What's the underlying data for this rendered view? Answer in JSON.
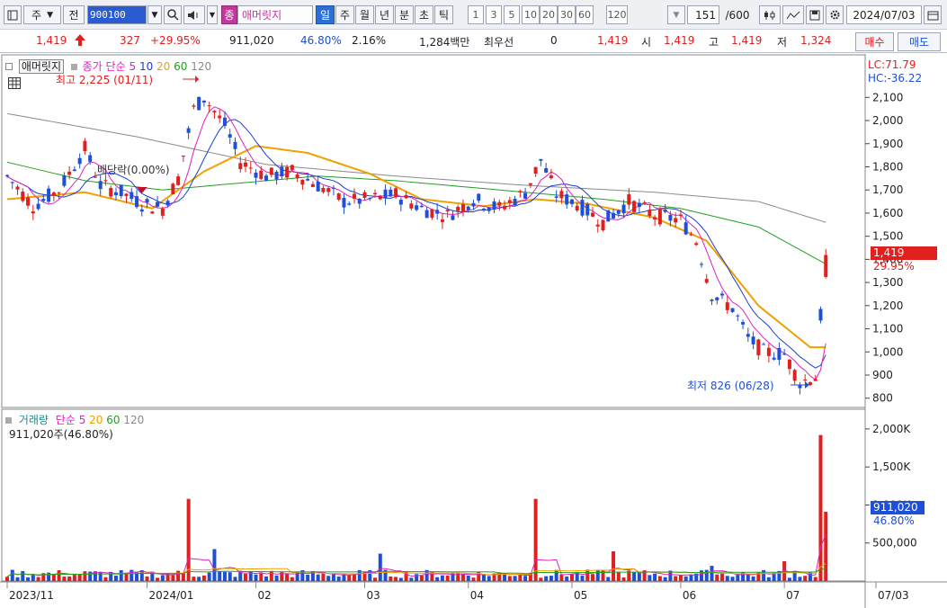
{
  "toolbar": {
    "market": "주",
    "prev": "전",
    "code": "900100",
    "name": "애머릿지",
    "name_badge": "종",
    "periods": [
      "일",
      "주",
      "월",
      "년",
      "분",
      "초",
      "틱"
    ],
    "active_period": "일",
    "intervals": [
      "1",
      "3",
      "5",
      "10",
      "20",
      "30",
      "60",
      "120"
    ],
    "count": "151",
    "count_max": "/600",
    "date": "2024/07/03"
  },
  "quote": {
    "price": "1,419",
    "change": "327",
    "change_pct": "+29.95%",
    "volume": "911,020",
    "volume_ratio": "46.80%",
    "turnover_pct": "2.16%",
    "amount": "1,284백만",
    "preferred_label": "최우선",
    "preferred_value": "0",
    "current": "1,419",
    "open_label": "시",
    "open": "1,419",
    "high_label": "고",
    "high": "1,419",
    "low_label": "저",
    "low": "1,324",
    "buy_label": "매수",
    "sell_label": "매도"
  },
  "legend": {
    "name": "애머릿지",
    "close_label": "종가 단순",
    "ma": [
      "5",
      "10",
      "20",
      "60",
      "120"
    ],
    "lc": "LC:71.79",
    "hc": "HC:-36.22",
    "high_note": "최고 2,225 (01/11)",
    "low_note": "최저 826 (06/28)",
    "dividend_note": "배당락(0.00%)",
    "price_tag": "1,419",
    "price_tag_pct": "29.95%"
  },
  "volume_legend": {
    "title": "거래량",
    "ma_label": "단순",
    "ma": [
      "5",
      "20",
      "60",
      "120"
    ],
    "current": "911,020주(46.80%)",
    "tag_value": "911,020",
    "tag_pct": "46.80%"
  },
  "colors": {
    "up": "#e0201e",
    "down": "#1e4fd8",
    "ma5": "#e020c0",
    "ma10": "#1a3fd0",
    "ma20": "#f0a000",
    "ma60": "#20a020",
    "ma120": "#8a8a8a"
  },
  "chart_data": {
    "type": "candlestick",
    "price_axis": {
      "ticks": [
        "2,100",
        "2,000",
        "1,900",
        "1,800",
        "1,700",
        "1,600",
        "1,500",
        "1,400",
        "1,300",
        "1,200",
        "1,100",
        "1,000",
        "900",
        "800"
      ],
      "range": [
        760,
        2280
      ]
    },
    "volume_axis": {
      "ticks": [
        "2,000K",
        "1,500K",
        "1,000K",
        "500,000"
      ],
      "range": [
        0,
        2200000
      ]
    },
    "x_labels": [
      "2023/11",
      "2024/01",
      "02",
      "03",
      "04",
      "05",
      "06",
      "07",
      "07/03"
    ],
    "ohlc_anchors": [
      [
        0,
        1760
      ],
      [
        5,
        1630
      ],
      [
        10,
        1700
      ],
      [
        15,
        1880
      ],
      [
        18,
        1720
      ],
      [
        22,
        1690
      ],
      [
        26,
        1640
      ],
      [
        30,
        1620
      ],
      [
        33,
        1750
      ],
      [
        36,
        2050
      ],
      [
        38,
        2100
      ],
      [
        42,
        1980
      ],
      [
        45,
        1820
      ],
      [
        50,
        1760
      ],
      [
        55,
        1780
      ],
      [
        60,
        1720
      ],
      [
        65,
        1650
      ],
      [
        70,
        1660
      ],
      [
        75,
        1680
      ],
      [
        80,
        1620
      ],
      [
        85,
        1590
      ],
      [
        90,
        1660
      ],
      [
        95,
        1620
      ],
      [
        100,
        1690
      ],
      [
        103,
        1830
      ],
      [
        106,
        1680
      ],
      [
        110,
        1640
      ],
      [
        115,
        1560
      ],
      [
        120,
        1650
      ],
      [
        125,
        1590
      ],
      [
        130,
        1570
      ],
      [
        133,
        1480
      ],
      [
        136,
        1250
      ],
      [
        140,
        1190
      ],
      [
        143,
        1060
      ],
      [
        146,
        1000
      ],
      [
        150,
        990
      ],
      [
        153,
        870
      ],
      [
        156,
        890
      ],
      [
        158,
        1419
      ]
    ],
    "volume_spikes": [
      [
        35,
        1080000
      ],
      [
        40,
        420000
      ],
      [
        72,
        360000
      ],
      [
        102,
        1080000
      ],
      [
        117,
        390000
      ],
      [
        136,
        200000
      ],
      [
        150,
        260000
      ],
      [
        157,
        1920000
      ],
      [
        158,
        911020
      ]
    ],
    "ma120_anchors": [
      [
        0,
        2030
      ],
      [
        25,
        1930
      ],
      [
        50,
        1810
      ],
      [
        75,
        1760
      ],
      [
        100,
        1720
      ],
      [
        125,
        1690
      ],
      [
        145,
        1650
      ],
      [
        158,
        1560
      ]
    ],
    "ma60_anchors": [
      [
        0,
        1820
      ],
      [
        15,
        1740
      ],
      [
        30,
        1700
      ],
      [
        45,
        1730
      ],
      [
        60,
        1760
      ],
      [
        75,
        1740
      ],
      [
        95,
        1700
      ],
      [
        115,
        1660
      ],
      [
        130,
        1620
      ],
      [
        145,
        1540
      ],
      [
        158,
        1380
      ]
    ],
    "ma20_anchors": [
      [
        0,
        1660
      ],
      [
        15,
        1690
      ],
      [
        28,
        1620
      ],
      [
        38,
        1780
      ],
      [
        48,
        1890
      ],
      [
        58,
        1860
      ],
      [
        70,
        1770
      ],
      [
        80,
        1660
      ],
      [
        92,
        1630
      ],
      [
        102,
        1660
      ],
      [
        112,
        1640
      ],
      [
        125,
        1580
      ],
      [
        135,
        1480
      ],
      [
        145,
        1200
      ],
      [
        155,
        1020
      ],
      [
        158,
        1020
      ]
    ]
  }
}
